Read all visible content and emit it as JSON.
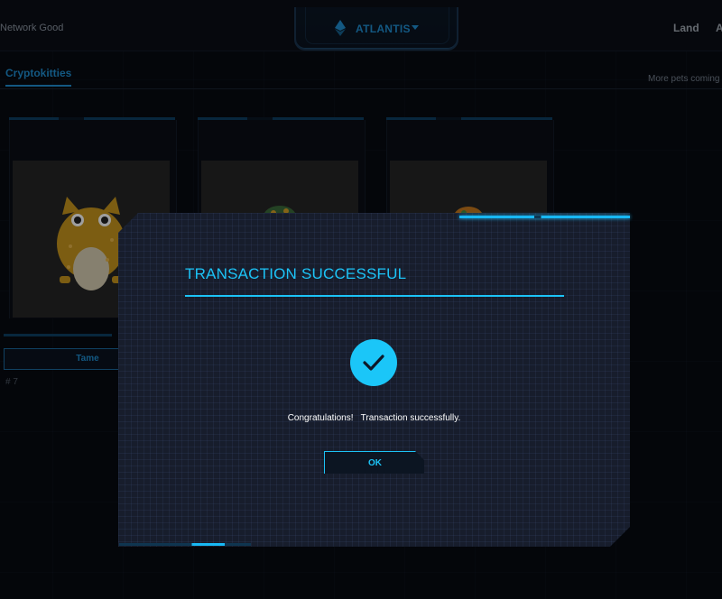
{
  "header": {
    "network_status": "Network Good",
    "network_name": "ATLANTIS",
    "nav": {
      "land": "Land",
      "more": "A"
    }
  },
  "tabs": {
    "active": "Cryptokitties",
    "more_pets": "More pets coming"
  },
  "cards": [
    {
      "button": "Tame",
      "id": "# 7"
    },
    {
      "button": "",
      "id": ""
    },
    {
      "button": "",
      "id": ""
    }
  ],
  "modal": {
    "title": "TRANSACTION SUCCESSFUL",
    "message": "Congratulations!   Transaction successfully.",
    "ok_label": "OK"
  },
  "colors": {
    "accent": "#1cc3f6",
    "background": "#070a11",
    "modal_bg": "#171d2c"
  },
  "icons": {
    "network": "ethereum-icon",
    "success": "checkmark-icon"
  }
}
